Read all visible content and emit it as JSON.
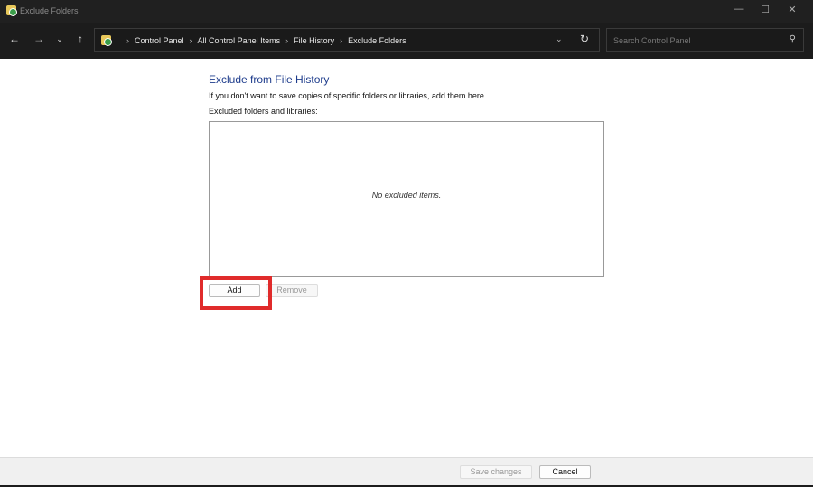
{
  "window": {
    "title": "Exclude Folders",
    "controls": [
      "minimize",
      "maximize",
      "close"
    ]
  },
  "nav": {
    "breadcrumb": [
      "Control Panel",
      "All Control Panel Items",
      "File History",
      "Exclude Folders"
    ],
    "search_placeholder": "Search Control Panel"
  },
  "main": {
    "heading": "Exclude from File History",
    "description": "If you don't want to save copies of specific folders or libraries, add them here.",
    "list_label": "Excluded folders and libraries:",
    "empty_text": "No excluded items.",
    "add_label": "Add",
    "remove_label": "Remove"
  },
  "footer": {
    "save_label": "Save changes",
    "cancel_label": "Cancel"
  },
  "colors": {
    "highlight": "#e02b2b",
    "heading": "#1e3c8c"
  }
}
